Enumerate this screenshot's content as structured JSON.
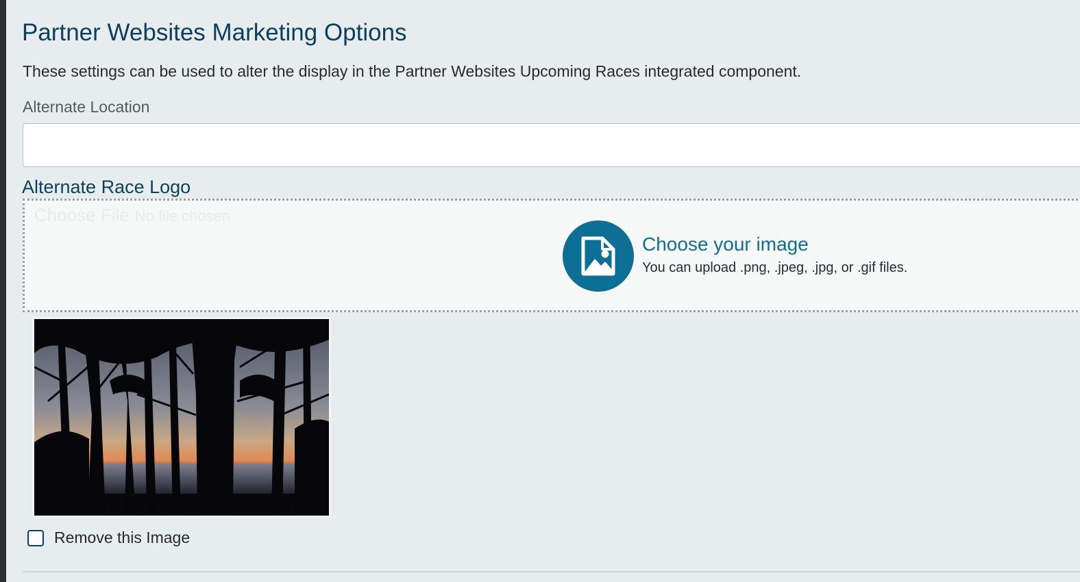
{
  "page": {
    "title": "Partner Websites Marketing Options",
    "intro": "These settings can be used to alter the display in the Partner Websites Upcoming Races integrated component."
  },
  "alternate_location": {
    "label": "Alternate Location",
    "value": ""
  },
  "alternate_race_logo": {
    "heading": "Alternate Race Logo",
    "file_input": {
      "button_label": "Choose File",
      "status_text": "No file chosen"
    },
    "upload": {
      "title": "Choose your image",
      "hint": "You can upload .png, .jpeg, .jpg, or .gif files.",
      "icon": "image-file-icon"
    },
    "preview": {
      "icon": "tree-silhouette-sunset-image"
    },
    "remove": {
      "label": "Remove this Image",
      "checked": false
    }
  },
  "colors": {
    "accent": "#0d6f93",
    "heading": "#0d3f5c",
    "background": "#e7ecef"
  }
}
